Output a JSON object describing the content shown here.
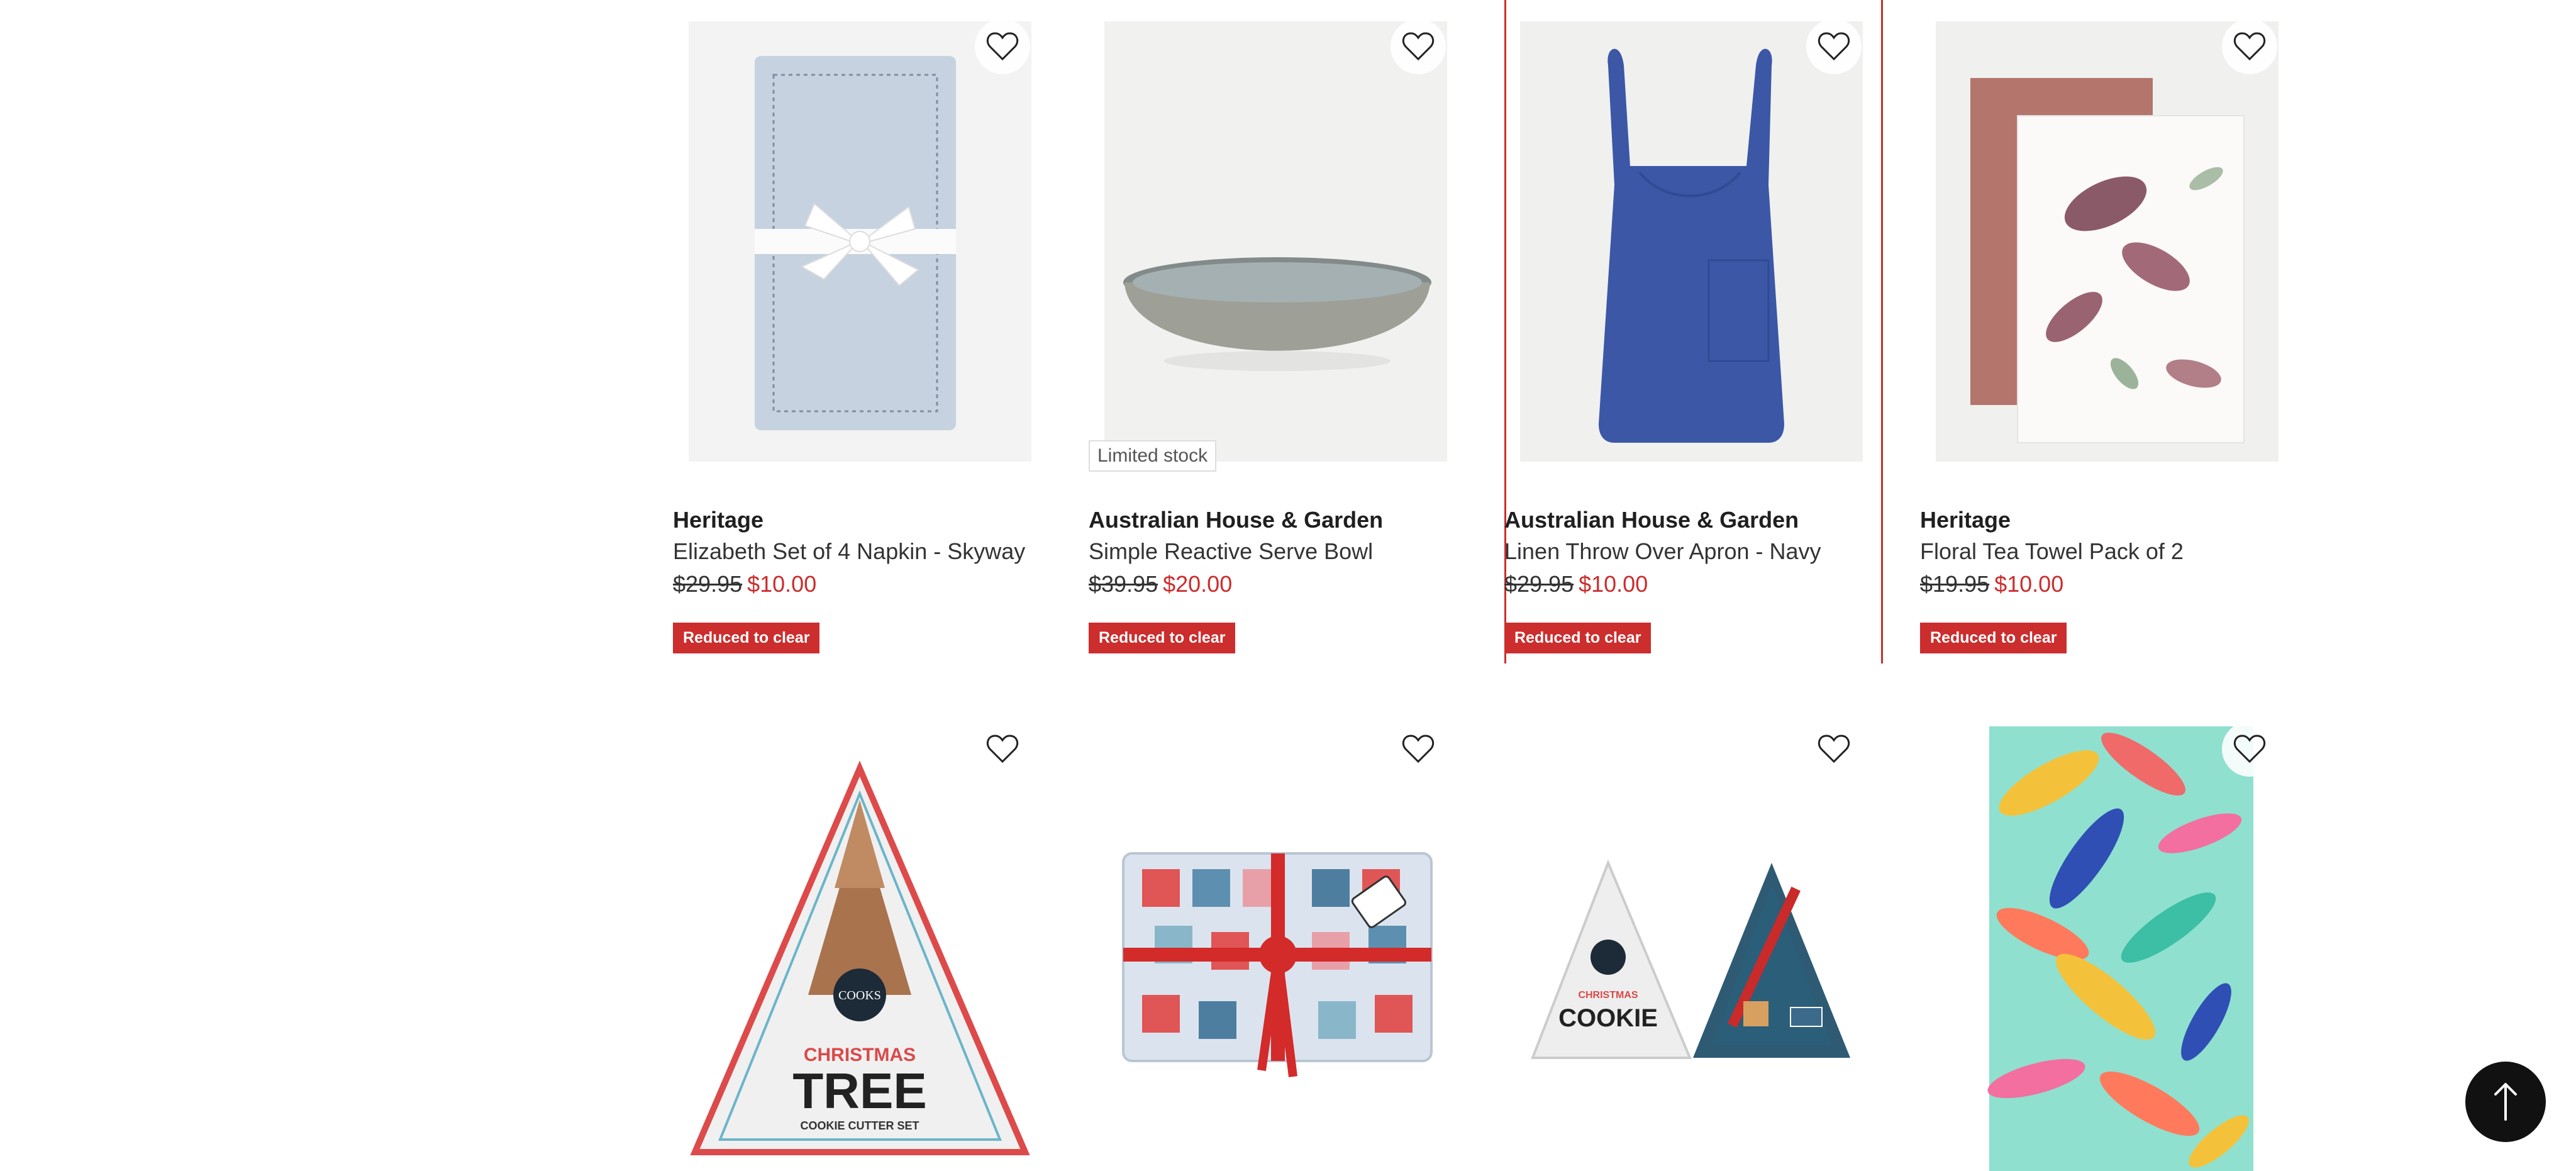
{
  "products": [
    {
      "brand": "Heritage",
      "name": "Elizabeth Set of 4 Napkin - Skyway",
      "was": "$29.95",
      "now": "$10.00",
      "badge": "Reduced to clear"
    },
    {
      "brand": "Australian House & Garden",
      "name": "Simple Reactive Serve Bowl",
      "was": "$39.95",
      "now": "$20.00",
      "badge": "Reduced to clear",
      "stock": "Limited stock"
    },
    {
      "brand": "Australian House & Garden",
      "name": "Linen Throw Over Apron - Navy",
      "was": "$29.95",
      "now": "$10.00",
      "badge": "Reduced to clear"
    },
    {
      "brand": "Heritage",
      "name": "Floral Tea Towel Pack of 2",
      "was": "$19.95",
      "now": "$10.00",
      "badge": "Reduced to clear"
    }
  ],
  "row2_images": [
    {
      "box_text": "CHRISTMAS",
      "box_title": "TREE",
      "box_sub": "COOKIE CUTTER SET",
      "logo": "COOKS"
    },
    {
      "kind": "gift-wrapped cookie cutter tray"
    },
    {
      "box_text": "CHRISTMAS",
      "box_title": "COOKIE"
    },
    {
      "kind": "tropical leaf print tea towel"
    }
  ],
  "icons": {
    "wishlist": "heart-outline-icon",
    "back_to_top": "arrow-up-icon"
  },
  "colors": {
    "accent": "#cc2d2d",
    "text": "#222222",
    "card_bg": "#f4f4f2"
  }
}
